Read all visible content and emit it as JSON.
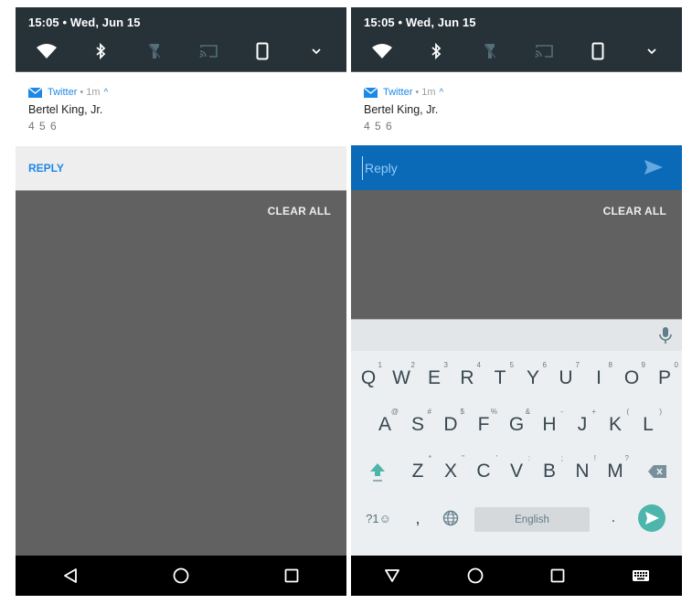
{
  "status": {
    "datetime": "15:05 • Wed, Jun 15"
  },
  "quick_settings": [
    {
      "name": "wifi",
      "state": "on"
    },
    {
      "name": "bluetooth",
      "state": "on"
    },
    {
      "name": "flashlight",
      "state": "off"
    },
    {
      "name": "cast",
      "state": "off"
    },
    {
      "name": "auto-rotate",
      "state": "on"
    },
    {
      "name": "expand",
      "state": "chevron"
    }
  ],
  "notification": {
    "app": "Twitter",
    "separator": "•",
    "time": "1m",
    "expand_glyph": "^",
    "title": "Bertel King, Jr.",
    "body": "4 5 6"
  },
  "left": {
    "reply_label": "REPLY",
    "clear_all": "CLEAR ALL"
  },
  "right": {
    "reply_placeholder": "Reply",
    "clear_all": "CLEAR ALL"
  },
  "keyboard": {
    "row1": [
      {
        "k": "Q",
        "h": "1"
      },
      {
        "k": "W",
        "h": "2"
      },
      {
        "k": "E",
        "h": "3"
      },
      {
        "k": "R",
        "h": "4"
      },
      {
        "k": "T",
        "h": "5"
      },
      {
        "k": "Y",
        "h": "6"
      },
      {
        "k": "U",
        "h": "7"
      },
      {
        "k": "I",
        "h": "8"
      },
      {
        "k": "O",
        "h": "9"
      },
      {
        "k": "P",
        "h": "0"
      }
    ],
    "row2": [
      {
        "k": "A",
        "h": "@"
      },
      {
        "k": "S",
        "h": "#"
      },
      {
        "k": "D",
        "h": "$"
      },
      {
        "k": "F",
        "h": "%"
      },
      {
        "k": "G",
        "h": "&"
      },
      {
        "k": "H",
        "h": "-"
      },
      {
        "k": "J",
        "h": "+"
      },
      {
        "k": "K",
        "h": "("
      },
      {
        "k": "L",
        "h": ")"
      }
    ],
    "row3": [
      {
        "k": "Z",
        "h": "*"
      },
      {
        "k": "X",
        "h": "\""
      },
      {
        "k": "C",
        "h": "'"
      },
      {
        "k": "V",
        "h": ":"
      },
      {
        "k": "B",
        "h": ";"
      },
      {
        "k": "N",
        "h": "!"
      },
      {
        "k": "M",
        "h": "?"
      }
    ],
    "symbols_label": "?1☺",
    "comma": ",",
    "period": ".",
    "space_label": "English",
    "accent_color": "#4db6ac"
  },
  "colors": {
    "qs_bg": "#263238",
    "reply_blue": "#0b6ab7",
    "link_blue": "#1e88e5",
    "shade": "#616161"
  }
}
